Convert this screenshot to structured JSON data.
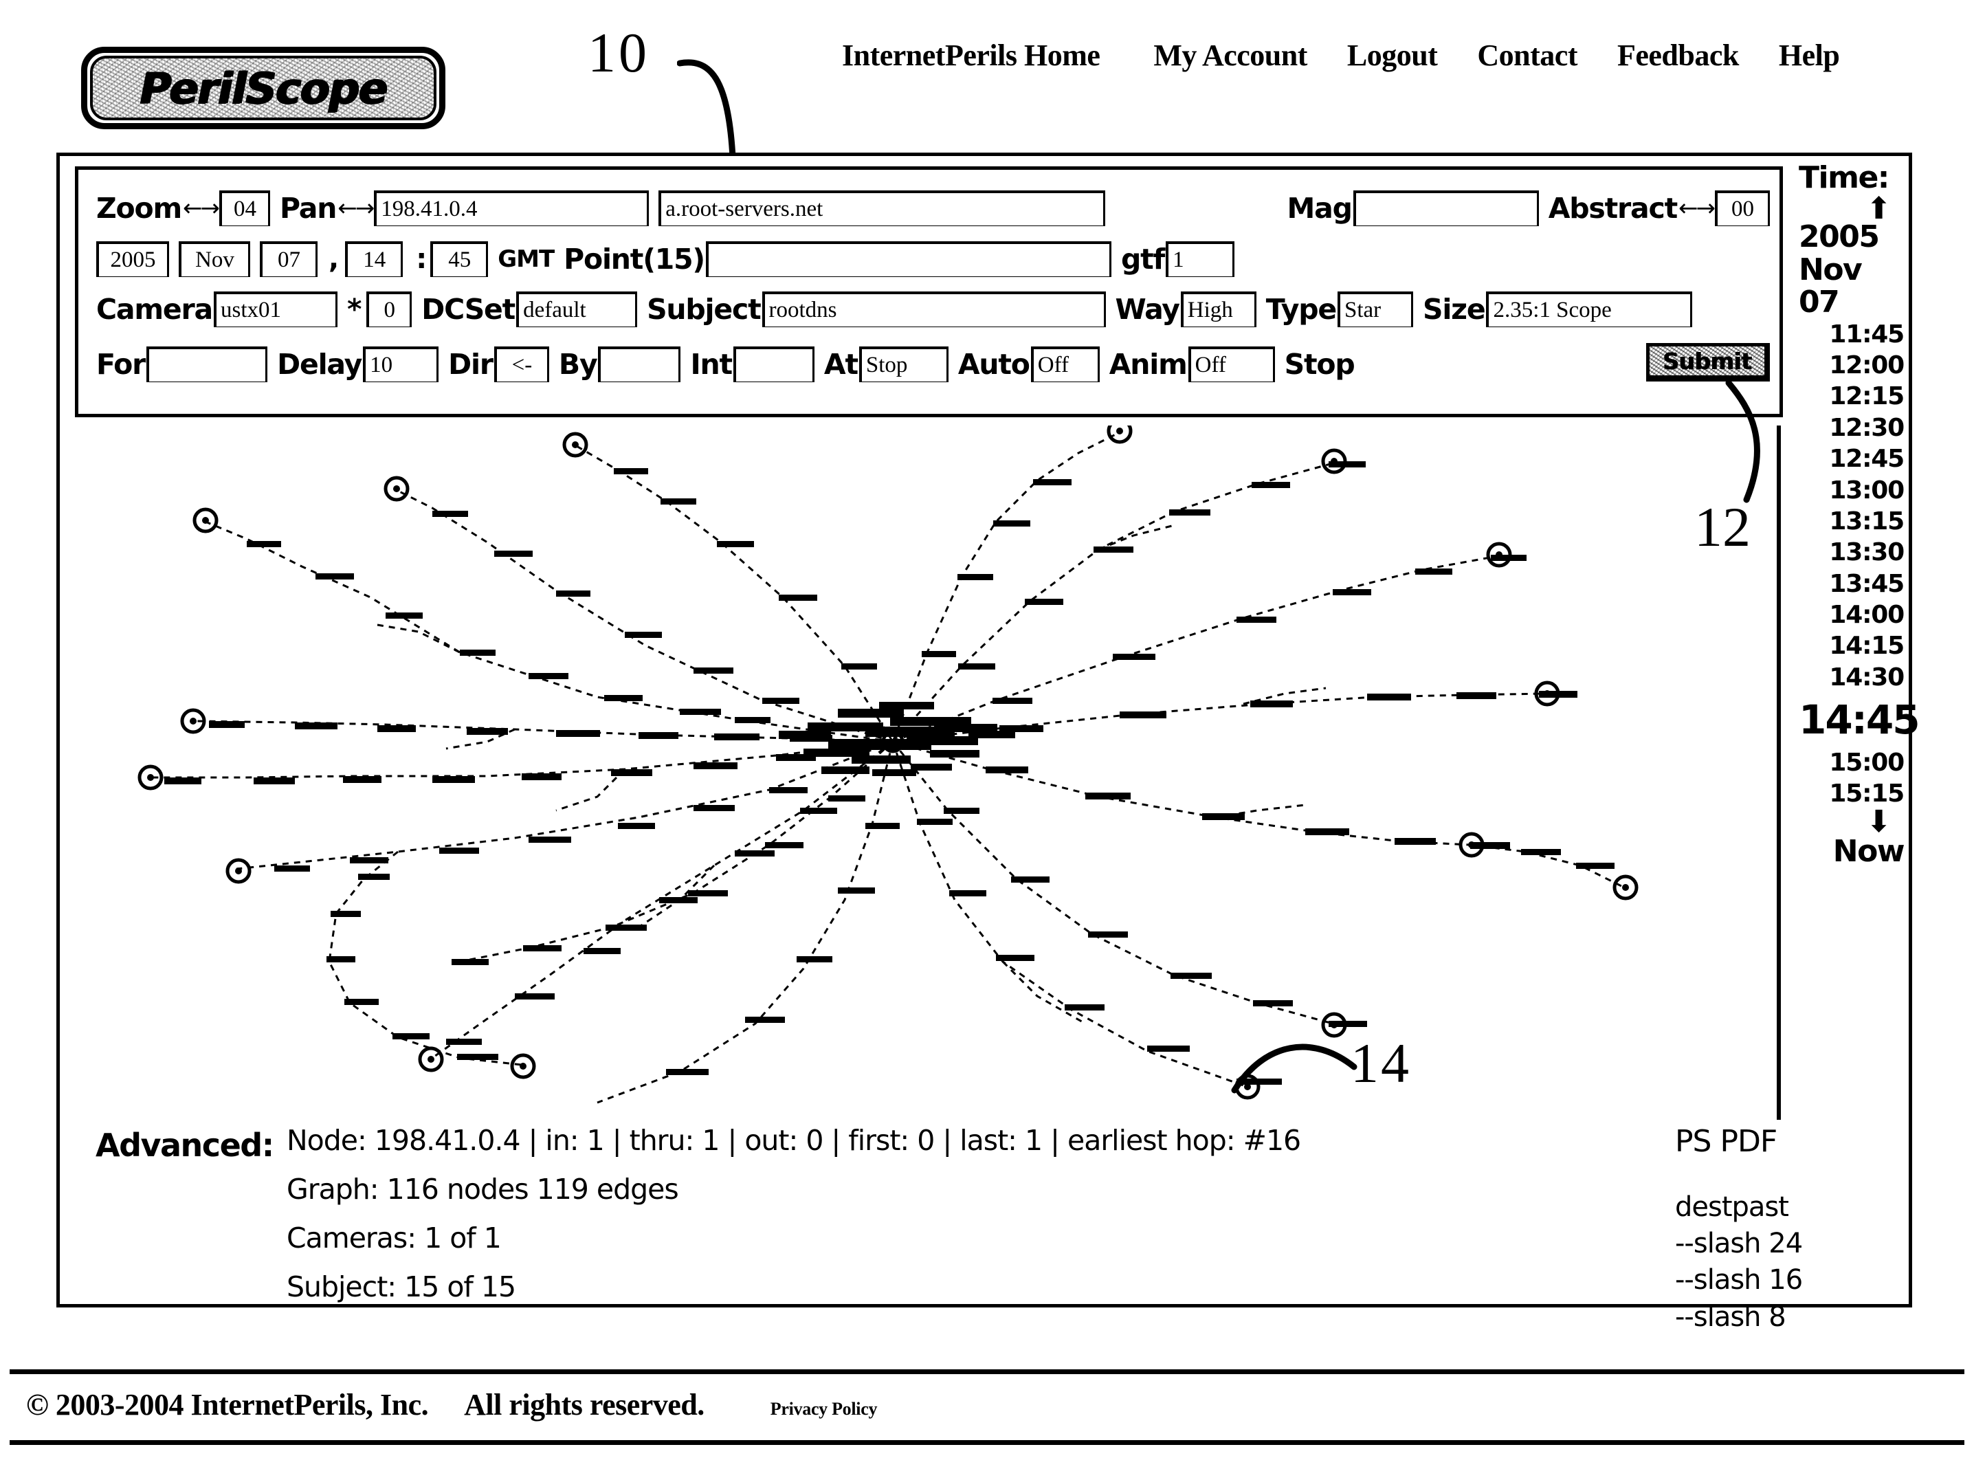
{
  "brand": {
    "logo_text": "PerilScope"
  },
  "topnav": {
    "items": [
      {
        "label": "InternetPerils Home"
      },
      {
        "label": "My Account"
      },
      {
        "label": "Logout"
      },
      {
        "label": "Contact"
      },
      {
        "label": "Feedback"
      },
      {
        "label": "Help"
      }
    ]
  },
  "callouts": {
    "panel": "10",
    "submit": "12",
    "graph": "14"
  },
  "controls": {
    "row1": {
      "zoom_label": "Zoom",
      "zoom_arrows": "←→",
      "zoom_value": "04",
      "pan_label": "Pan",
      "pan_arrows": "←→",
      "pan_value": "198.41.0.4",
      "host_value": "a.root-servers.net",
      "mag_label": "Mag",
      "mag_value": "",
      "abstract_label": "Abstract",
      "abstract_arrows": "←→",
      "abstract_value": "00"
    },
    "row2": {
      "year": "2005",
      "month": "Nov",
      "day": "07",
      "comma": ",",
      "hour": "14",
      "colon": ":",
      "minute": "45",
      "tz_label": "GMT",
      "point_label": "Point(15)",
      "point_value": "",
      "gtf_label": "gtf",
      "gtf_value": "1"
    },
    "row3": {
      "camera_label": "Camera",
      "camera_value": "ustx01",
      "star_label": "*",
      "star_value": "0",
      "dcset_label": "DCSet",
      "dcset_value": "default",
      "subject_label": "Subject",
      "subject_value": "rootdns",
      "way_label": "Way",
      "way_value": "High",
      "type_label": "Type",
      "type_value": "Star",
      "size_label": "Size",
      "size_value": "2.35:1 Scope"
    },
    "row4": {
      "for_label": "For",
      "for_value": "",
      "delay_label": "Delay",
      "delay_value": "10",
      "dir_label": "Dir",
      "dir_value": "<-",
      "by_label": "By",
      "by_value": "",
      "int_label": "Int",
      "int_value": "",
      "at_label": "At",
      "at_value": "Stop",
      "auto_label": "Auto",
      "auto_value": "Off",
      "anim_label": "Anim",
      "anim_value": "Off",
      "stop_label": "Stop",
      "submit_label": "Submit"
    }
  },
  "timebar": {
    "title": "Time:",
    "up_arrow": "⬆",
    "down_arrow": "⬇",
    "year": "2005",
    "date": "Nov 07",
    "ticks": [
      "11:45",
      "12:00",
      "12:15",
      "12:30",
      "12:45",
      "13:00",
      "13:15",
      "13:30",
      "13:45",
      "14:00",
      "14:15",
      "14:30",
      "14:45",
      "15:00",
      "15:15"
    ],
    "selected": "14:45",
    "now_label": "Now"
  },
  "advanced": {
    "label": "Advanced:",
    "node_line": "Node: 198.41.0.4 | in: 1 | thru: 1 | out: 0 | first: 0 | last: 1 | earliest hop: #16",
    "graph_line": "Graph: 116 nodes 119 edges",
    "cameras_line": "Cameras: 1 of 1",
    "subject_line": "Subject: 15 of 15",
    "export_label": "PS PDF",
    "destpast_label": "destpast",
    "slash_links": [
      "--slash 24",
      "--slash 16",
      "--slash 8"
    ]
  },
  "graph": {
    "type": "network-star-topology",
    "node_count": 116,
    "edge_count": 119,
    "center_label": "198.41.0.4",
    "leaf_markers": 16
  },
  "footer": {
    "copyright": "© 2003-2004 InternetPerils, Inc.",
    "rights": "All rights reserved.",
    "privacy": "Privacy Policy"
  }
}
